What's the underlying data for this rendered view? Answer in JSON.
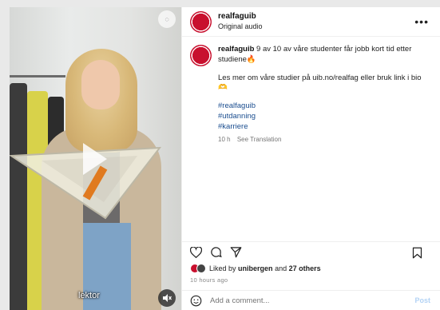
{
  "video": {
    "caption": "lektor"
  },
  "header": {
    "username": "realfaguib",
    "audio": "Original audio",
    "more_label": "•••"
  },
  "post": {
    "username": "realfaguib",
    "text_line1": "9 av 10 av våre studenter får jobb kort tid etter studiene🔥",
    "text_line2": "Les mer om våre studier på uib.no/realfag eller bruk link i bio 🫶",
    "tags": [
      "#realfaguib",
      "#utdanning",
      "#karriere"
    ],
    "time": "10 h",
    "see_translation": "See Translation"
  },
  "likes": {
    "prefix": "Liked by",
    "user": "unibergen",
    "and": "and",
    "others": "27 others"
  },
  "ago": "10 hours ago",
  "comment": {
    "placeholder": "Add a comment...",
    "post_label": "Post"
  },
  "colors": {
    "brand": "#c8102e",
    "link": "#1a4d8f"
  }
}
